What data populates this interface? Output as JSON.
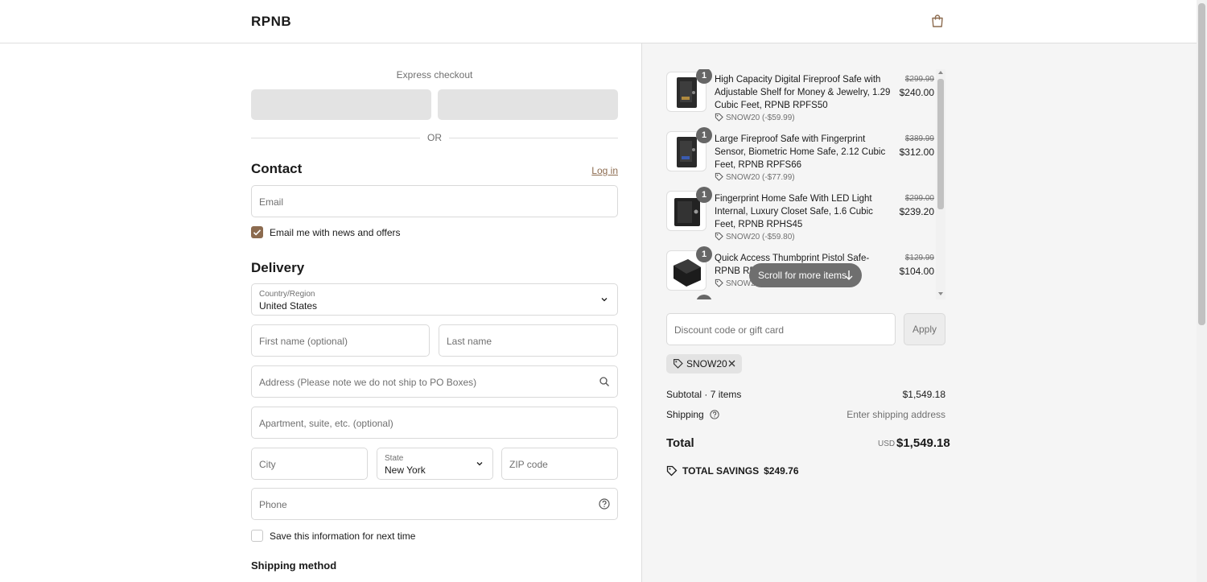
{
  "header": {
    "brand": "RPNB",
    "cart_icon": "shopping-bag-icon"
  },
  "express": {
    "label": "Express checkout",
    "or": "OR"
  },
  "contact": {
    "title": "Contact",
    "login": "Log in",
    "email_placeholder": "Email",
    "news_label": "Email me with news and offers",
    "news_checked": true
  },
  "delivery": {
    "title": "Delivery",
    "country_label": "Country/Region",
    "country_value": "United States",
    "first_name_placeholder": "First name (optional)",
    "last_name_placeholder": "Last name",
    "address_placeholder": "Address (Please note we do not ship to PO Boxes)",
    "apartment_placeholder": "Apartment, suite, etc. (optional)",
    "city_placeholder": "City",
    "state_label": "State",
    "state_value": "New York",
    "zip_placeholder": "ZIP code",
    "phone_placeholder": "Phone",
    "save_label": "Save this information for next time",
    "save_checked": false
  },
  "shipping_method": {
    "title": "Shipping method"
  },
  "order": {
    "items": [
      {
        "qty": "1",
        "title": "High Capacity Digital Fireproof Safe with Adjustable Shelf for Money & Jewelry, 1.29 Cubic Feet, RPNB RPFS50",
        "discount": "SNOW20 (-$59.99)",
        "original_price": "$299.99",
        "price": "$240.00"
      },
      {
        "qty": "1",
        "title": "Large Fireproof Safe with Fingerprint Sensor, Biometric Home Safe, 2.12 Cubic Feet, RPNB RPFS66",
        "discount": "SNOW20 (-$77.99)",
        "original_price": "$389.99",
        "price": "$312.00"
      },
      {
        "qty": "1",
        "title": "Fingerprint Home Safe With LED Light Internal, Luxury Closet Safe, 1.6 Cubic Feet, RPNB RPHS45",
        "discount": "SNOW20 (-$59.80)",
        "original_price": "$299.00",
        "price": "$239.20"
      },
      {
        "qty": "1",
        "title": "Quick Access Thumbprint Pistol Safe-RPNB RP2002",
        "discount": "SNOW20 (-$25.99)",
        "original_price": "$129.99",
        "price": "$104.00"
      }
    ],
    "scroll_hint": "Scroll for more items",
    "discount_placeholder": "Discount code or gift card",
    "apply": "Apply",
    "applied_code": "SNOW20",
    "subtotal_label": "Subtotal · 7 items",
    "subtotal_value": "$1,549.18",
    "shipping_label": "Shipping",
    "shipping_value": "Enter shipping address",
    "total_label": "Total",
    "currency": "USD",
    "total_value": "$1,549.18",
    "savings_label": "TOTAL SAVINGS",
    "savings_value": "$249.76"
  },
  "colors": {
    "accent": "#8c6b4f",
    "summary_bg": "#f5f5f5",
    "badge": "#666666"
  }
}
